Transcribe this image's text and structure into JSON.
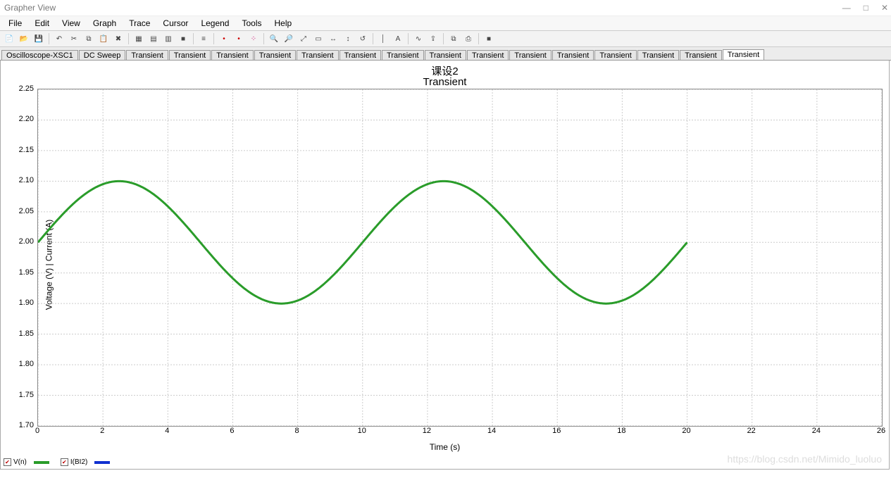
{
  "window": {
    "title": "Grapher View",
    "min": "—",
    "max": "□",
    "close": "✕"
  },
  "menubar": [
    "File",
    "Edit",
    "View",
    "Graph",
    "Trace",
    "Cursor",
    "Legend",
    "Tools",
    "Help"
  ],
  "tabs": [
    {
      "label": "Oscilloscope-XSC1",
      "active": false
    },
    {
      "label": "DC Sweep",
      "active": false
    },
    {
      "label": "Transient",
      "active": false
    },
    {
      "label": "Transient",
      "active": false
    },
    {
      "label": "Transient",
      "active": false
    },
    {
      "label": "Transient",
      "active": false
    },
    {
      "label": "Transient",
      "active": false
    },
    {
      "label": "Transient",
      "active": false
    },
    {
      "label": "Transient",
      "active": false
    },
    {
      "label": "Transient",
      "active": false
    },
    {
      "label": "Transient",
      "active": false
    },
    {
      "label": "Transient",
      "active": false
    },
    {
      "label": "Transient",
      "active": false
    },
    {
      "label": "Transient",
      "active": false
    },
    {
      "label": "Transient",
      "active": false
    },
    {
      "label": "Transient",
      "active": false
    },
    {
      "label": "Transient",
      "active": true
    }
  ],
  "toolbar_icons": [
    "new",
    "open",
    "save",
    "sep",
    "undo",
    "cut",
    "copy",
    "paste",
    "delete",
    "sep",
    "grid",
    "axes",
    "panel",
    "black-bg",
    "sep",
    "legend",
    "sep",
    "marker-red",
    "marker-red2",
    "marker-multi",
    "sep",
    "zoom-in",
    "zoom-out",
    "zoom-fit",
    "zoom-window",
    "zoom-x",
    "zoom-y",
    "zoom-prev",
    "sep",
    "cursor",
    "text",
    "sep",
    "measure",
    "export",
    "sep",
    "copy-img",
    "print",
    "sep",
    "stop"
  ],
  "plot": {
    "title": "课设2",
    "subtitle": "Transient",
    "xlabel": "Time (s)",
    "ylabel": "Voltage (V) | Current (A)"
  },
  "legend": [
    {
      "name": "V(n)",
      "color": "#2a9c2a"
    },
    {
      "name": "I(BI2)",
      "color": "#1030d0"
    }
  ],
  "watermark": "https://blog.csdn.net/Mimido_luoluo",
  "chart_data": {
    "type": "line",
    "title": "课设2 — Transient",
    "xlabel": "Time (s)",
    "ylabel": "Voltage (V) | Current (A)",
    "xlim": [
      0,
      26
    ],
    "ylim": [
      1.7,
      2.25
    ],
    "xticks": [
      0,
      2,
      4,
      6,
      8,
      10,
      12,
      14,
      16,
      18,
      20,
      22,
      24,
      26
    ],
    "yticks": [
      1.7,
      1.75,
      1.8,
      1.85,
      1.9,
      1.95,
      2.0,
      2.05,
      2.1,
      2.15,
      2.2,
      2.25
    ],
    "grid": true,
    "series": [
      {
        "name": "V(n)",
        "color": "#2a9c2a",
        "x": [
          0,
          1,
          2,
          2.5,
          3,
          4,
          5,
          6,
          7,
          7.5,
          8,
          9,
          10,
          11,
          12,
          12.5,
          13,
          14,
          15,
          16,
          17,
          17.5,
          18,
          19,
          20
        ],
        "y": [
          2.0,
          2.059,
          2.095,
          2.1,
          2.095,
          2.059,
          2.0,
          1.941,
          1.905,
          1.9,
          1.905,
          1.941,
          2.0,
          2.059,
          2.095,
          2.1,
          2.095,
          2.059,
          2.0,
          1.941,
          1.905,
          1.9,
          1.905,
          1.941,
          2.0
        ],
        "note": "offset 2.0 V, amplitude 0.10, period 10 s, phase leads such that peak at t≈2.5 s"
      }
    ]
  }
}
